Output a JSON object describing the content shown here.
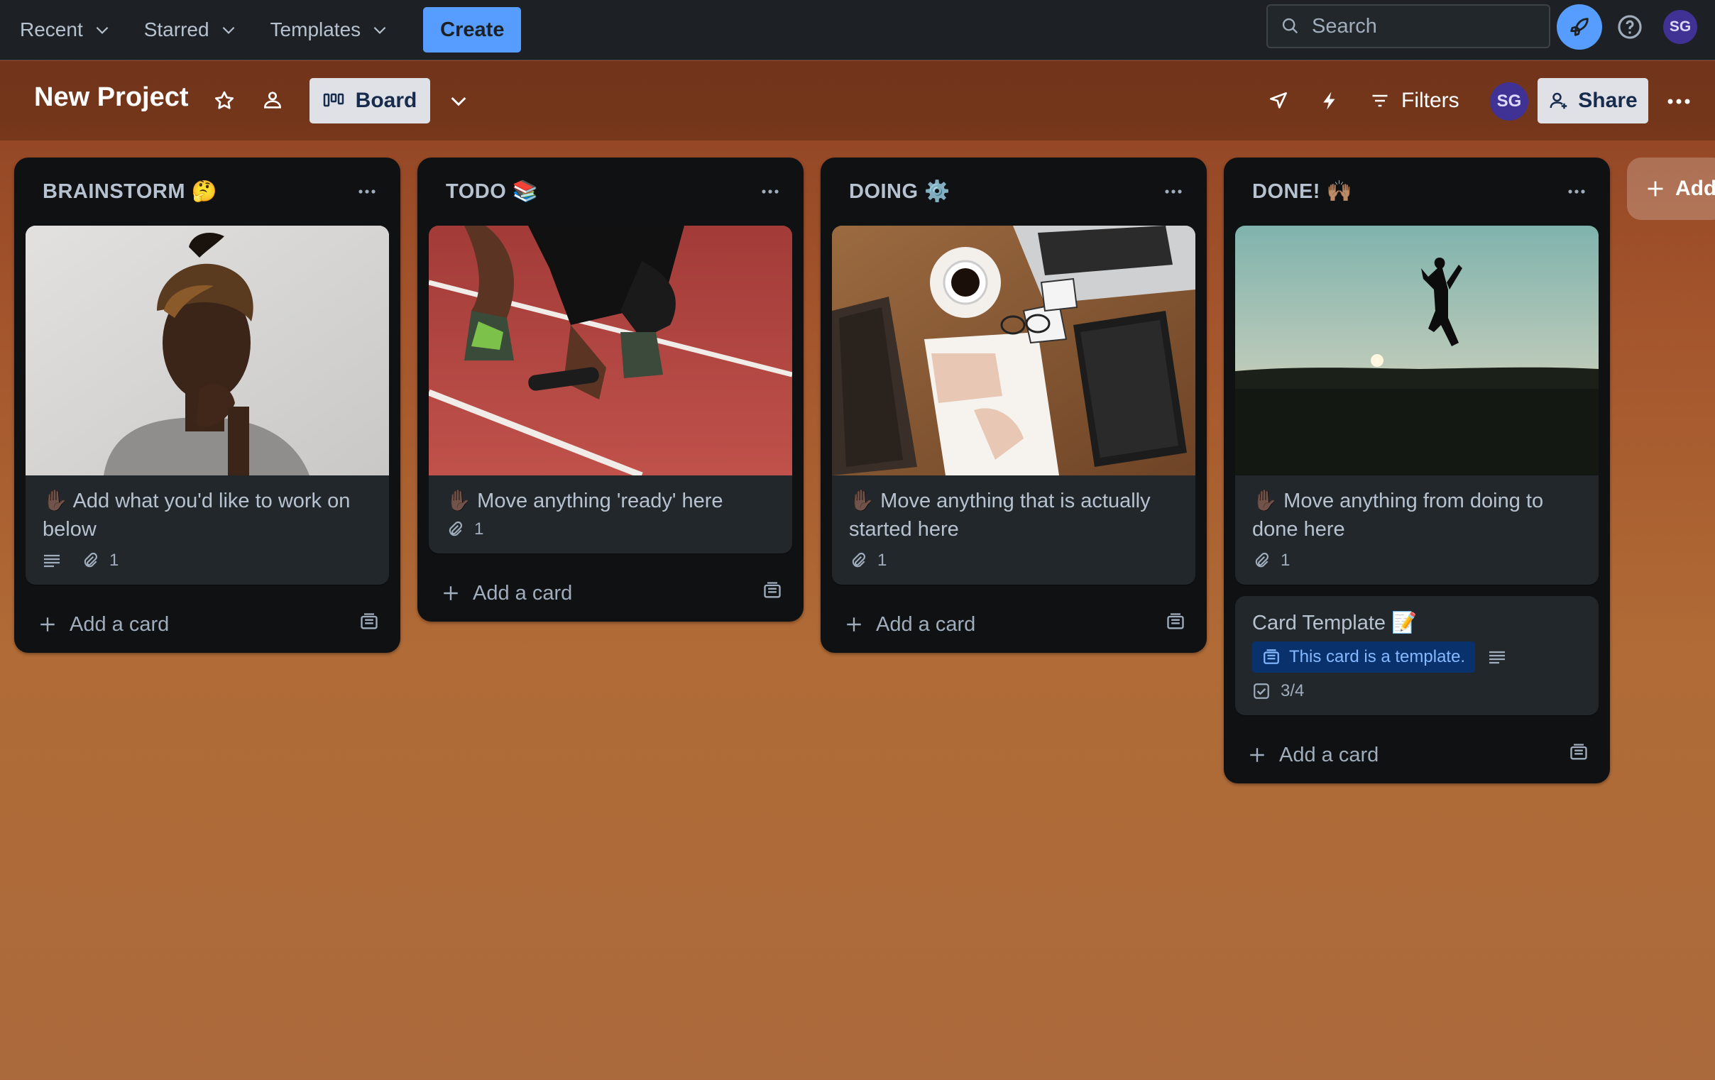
{
  "nav": {
    "menus": [
      {
        "label": "Recent"
      },
      {
        "label": "Starred"
      },
      {
        "label": "Templates"
      }
    ],
    "create_label": "Create",
    "search_placeholder": "Search",
    "user_initials": "SG"
  },
  "board": {
    "title": "New Project",
    "view_label": "Board",
    "filters_label": "Filters",
    "share_label": "Share",
    "member_initials": "SG"
  },
  "lists": [
    {
      "title": "BRAINSTORM 🤔",
      "cards": [
        {
          "title": "✋🏿 Add what you'd like to work on below",
          "has_description": true,
          "attachments": "1",
          "cover": "thinking-woman-photo"
        }
      ],
      "add_card_label": "Add a card"
    },
    {
      "title": "TODO 📚",
      "cards": [
        {
          "title": "✋🏿 Move anything 'ready' here",
          "has_description": false,
          "attachments": "1",
          "cover": "sprinter-track-photo"
        }
      ],
      "add_card_label": "Add a card"
    },
    {
      "title": "DOING ⚙️",
      "cards": [
        {
          "title": "✋🏿 Move anything that is actually started here",
          "has_description": false,
          "attachments": "1",
          "cover": "desk-workspace-photo"
        }
      ],
      "add_card_label": "Add a card"
    },
    {
      "title": "DONE! 🙌🏽",
      "cards": [
        {
          "title": "✋🏿 Move anything from doing to done here",
          "has_description": false,
          "attachments": "1",
          "cover": "jumping-sunset-photo"
        },
        {
          "title": "Card Template 📝",
          "template_tag": "This card is a template.",
          "checklist": "3/4"
        }
      ],
      "add_card_label": "Add a card"
    }
  ],
  "add_list_label": "Add",
  "colors": {
    "accent": "#579dff",
    "nav_bg": "#1d2125",
    "list_bg": "#0f1113",
    "card_bg": "#22272b",
    "avatar_bg": "#403294"
  }
}
